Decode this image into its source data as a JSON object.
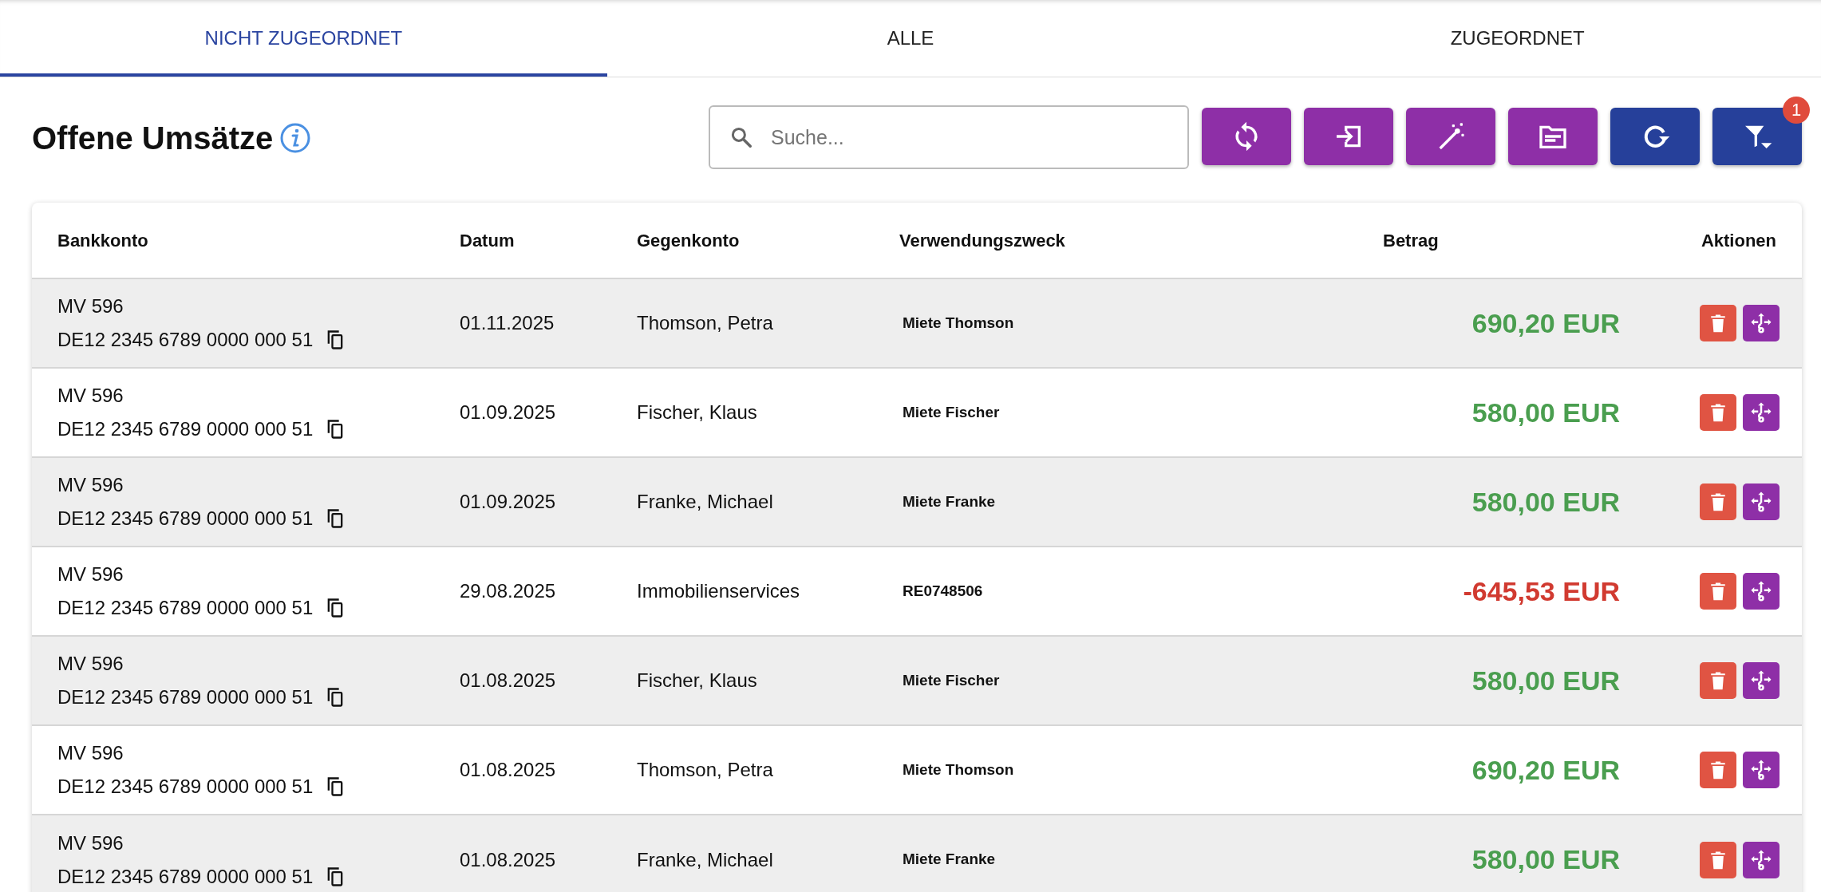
{
  "tabs": [
    {
      "label": "NICHT ZUGEORDNET",
      "selected": true
    },
    {
      "label": "ALLE",
      "selected": false
    },
    {
      "label": "ZUGEORDNET",
      "selected": false
    }
  ],
  "title": "Offene Umsätze",
  "search": {
    "placeholder": "Suche..."
  },
  "toolbar": [
    {
      "kind": "sync",
      "color": "#8e2fa7"
    },
    {
      "kind": "import",
      "color": "#8e2fa7"
    },
    {
      "kind": "magic",
      "color": "#8e2fa7"
    },
    {
      "kind": "folder",
      "color": "#8e2fa7"
    },
    {
      "kind": "refresh",
      "color": "#26409a"
    },
    {
      "kind": "filter",
      "color": "#26409a",
      "badge": "1"
    }
  ],
  "table": {
    "columns": [
      "Bankkonto",
      "Datum",
      "Gegenkonto",
      "Verwendungszweck",
      "Betrag",
      "Aktionen"
    ],
    "rows": [
      {
        "account": "MV 596",
        "iban": "DE12 2345 6789 0000 000 51",
        "date": "01.11.2025",
        "counterparty": "Thomson, Petra",
        "purpose": "Miete Thomson",
        "amount": "690,20 EUR",
        "kind": "credit"
      },
      {
        "account": "MV 596",
        "iban": "DE12 2345 6789 0000 000 51",
        "date": "01.09.2025",
        "counterparty": "Fischer, Klaus",
        "purpose": "Miete Fischer",
        "amount": "580,00 EUR",
        "kind": "credit"
      },
      {
        "account": "MV 596",
        "iban": "DE12 2345 6789 0000 000 51",
        "date": "01.09.2025",
        "counterparty": "Franke, Michael",
        "purpose": "Miete Franke",
        "amount": "580,00 EUR",
        "kind": "credit"
      },
      {
        "account": "MV 596",
        "iban": "DE12 2345 6789 0000 000 51",
        "date": "29.08.2025",
        "counterparty": "Immobilienservices",
        "purpose": "RE0748506",
        "amount": "-645,53 EUR",
        "kind": "debit"
      },
      {
        "account": "MV 596",
        "iban": "DE12 2345 6789 0000 000 51",
        "date": "01.08.2025",
        "counterparty": "Fischer, Klaus",
        "purpose": "Miete Fischer",
        "amount": "580,00 EUR",
        "kind": "credit"
      },
      {
        "account": "MV 596",
        "iban": "DE12 2345 6789 0000 000 51",
        "date": "01.08.2025",
        "counterparty": "Thomson, Petra",
        "purpose": "Miete Thomson",
        "amount": "690,20 EUR",
        "kind": "credit"
      },
      {
        "account": "MV 596",
        "iban": "DE12 2345 6789 0000 000 51",
        "date": "01.08.2025",
        "counterparty": "Franke, Michael",
        "purpose": "Miete Franke",
        "amount": "580,00 EUR",
        "kind": "credit"
      }
    ]
  }
}
